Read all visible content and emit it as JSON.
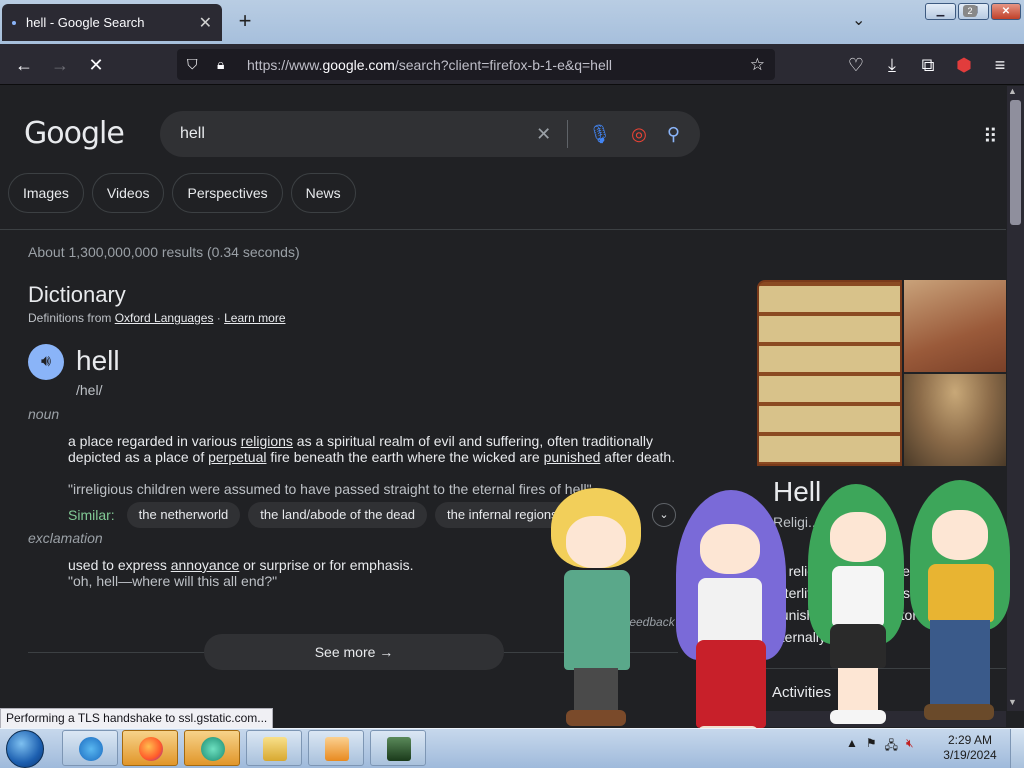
{
  "browser": {
    "tab_title": "hell - Google Search",
    "new_tab_icon": "+",
    "url_prefix": "https://www.",
    "url_domain": "google.com",
    "url_rest": "/search?client=firefox-b-1-e&q=hell",
    "extension_badge": "2"
  },
  "search": {
    "logo": "Google",
    "query": "hell",
    "chips": [
      "Images",
      "Videos",
      "Perspectives",
      "News"
    ],
    "stats": "About 1,300,000,000 results (0.34 seconds)"
  },
  "dictionary": {
    "title": "Dictionary",
    "source_prefix": "Definitions from ",
    "source_name": "Oxford Languages",
    "source_sep": " · ",
    "learn_more": "Learn more",
    "word": "hell",
    "phonetic": "/hel/",
    "pos1": "noun",
    "def1_a": "a place regarded in various ",
    "def1_link1": "religions",
    "def1_b": " as a spiritual realm of evil and suffering, often traditionally depicted as a place of ",
    "def1_link2": "perpetual",
    "def1_c": " fire beneath the earth where the wicked are ",
    "def1_link3": "punished",
    "def1_d": " after death.",
    "example1": "\"irreligious children were assumed to have passed straight to the eternal fires of hell\"",
    "similar_label": "Similar:",
    "similar": [
      "the netherworld",
      "the land/abode of the dead",
      "the infernal regions"
    ],
    "pos2": "exclamation",
    "def2_a": "used to express ",
    "def2_link": "annoyance",
    "def2_b": " or surprise or for emphasis.",
    "example2": "\"oh, hell—where will this all end?\"",
    "feedback": "Feedback",
    "see_more": "See more"
  },
  "knowledge_panel": {
    "title": "Hell",
    "subtitle": "Religi...",
    "description": "In religion and folklore, hell is ... afterlife in which souls are ... punished ... through torture ... eternally",
    "activities": "Activities"
  },
  "status_bar": "Performing a TLS handshake to ssl.gstatic.com...",
  "taskbar": {
    "time": "2:29 AM",
    "date": "3/19/2024"
  },
  "colors": {
    "accent_blue": "#8ab4f8",
    "similar_green": "#81c995",
    "page_bg": "#202124"
  }
}
